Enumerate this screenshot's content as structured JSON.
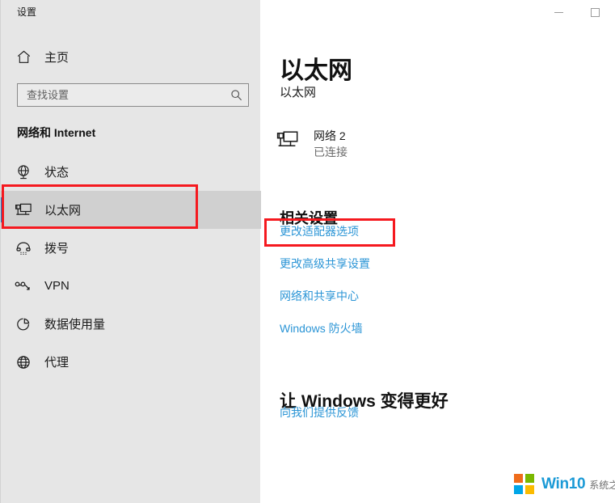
{
  "window": {
    "caption": "设置",
    "controls": [
      {
        "name": "minimize",
        "glyph": "minimize-icon",
        "label": "—"
      },
      {
        "name": "maximize",
        "glyph": "maximize-icon",
        "label": "□"
      }
    ]
  },
  "sidebar": {
    "home": {
      "label": "主页",
      "icon": "home-icon"
    },
    "search": {
      "value": "",
      "placeholder": "查找设置",
      "icon": "search-icon"
    },
    "group_title": "网络和 Internet",
    "items": [
      {
        "label": "状态",
        "icon": "status-globe-icon",
        "selected": false
      },
      {
        "label": "以太网",
        "icon": "ethernet-icon",
        "selected": true
      },
      {
        "label": "拨号",
        "icon": "dialup-phone-icon",
        "selected": false
      },
      {
        "label": "VPN",
        "icon": "vpn-icon",
        "selected": false
      },
      {
        "label": "数据使用量",
        "icon": "data-usage-pie-icon",
        "selected": false
      },
      {
        "label": "代理",
        "icon": "proxy-globe-icon",
        "selected": false
      }
    ]
  },
  "content": {
    "heading": "以太网",
    "section_label": "以太网",
    "adapter": {
      "icon": "ethernet-adapter-icon",
      "name": "网络 2",
      "status": "已连接"
    },
    "related": {
      "heading": "相关设置",
      "links": [
        "更改适配器选项",
        "更改高级共享设置",
        "网络和共享中心",
        "Windows 防火墙"
      ]
    },
    "feedback": {
      "heading": "让 Windows 变得更好",
      "link": "向我们提供反馈"
    }
  },
  "watermark": {
    "brand": "Win10",
    "subtitle": "系统之家",
    "logo_colors": [
      "#ef6c1b",
      "#7ab800",
      "#00a6e8",
      "#fbbb00"
    ]
  },
  "colors": {
    "accent": "#0a84d8",
    "link": "#2b95d6",
    "annotation": "#f5191f",
    "sidebar_bg": "#e6e6e6",
    "selected_bg": "#d0d0d0",
    "content_bg": "#ffffff"
  }
}
